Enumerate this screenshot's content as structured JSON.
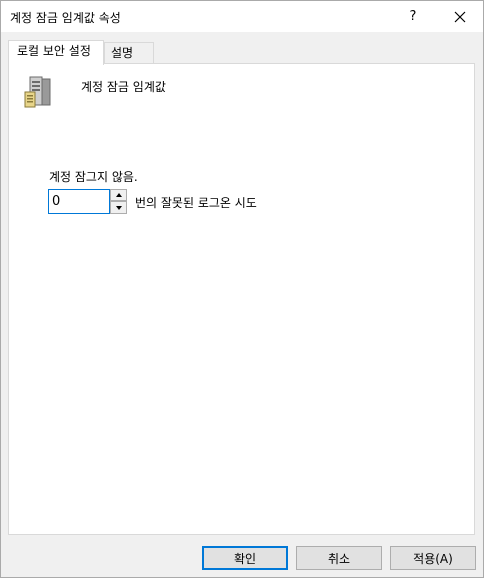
{
  "window": {
    "title": "계정 잠금 임계값 속성",
    "help_label": "?",
    "close_label": "✕"
  },
  "tabs": [
    {
      "label": "로컬 보안 설정",
      "active": true
    },
    {
      "label": "설명",
      "active": false
    }
  ],
  "policy": {
    "icon": "server-icon",
    "title": "계정 잠금 임계값"
  },
  "setting": {
    "status_text": "계정 잠그지 않음.",
    "value": "0",
    "suffix_label": "번의 잘못된 로그온 시도"
  },
  "buttons": {
    "ok_label": "확인",
    "cancel_label": "취소",
    "apply_label": "적용(A)"
  },
  "colors": {
    "accent": "#0078d7",
    "panel": "#ffffff",
    "background": "#f0f0f0"
  }
}
